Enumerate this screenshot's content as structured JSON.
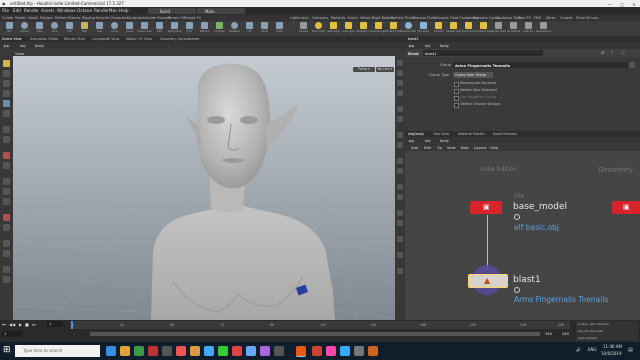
{
  "window": {
    "title": "untitled.hip - Houdini Indie Limited-Commercial 17.5.327",
    "minimize": "—",
    "maximize": "□",
    "close": "✕"
  },
  "menubar": {
    "items": [
      "File",
      "Edit",
      "Render",
      "Assets",
      "Windows",
      "Octane",
      "RenderMan",
      "Help"
    ],
    "build_label": "Build",
    "desktop_label": "Main"
  },
  "shelf_tabs": {
    "left": [
      "Create",
      "Modify",
      "Model",
      "Polygon",
      "Deform",
      "Texture",
      "Rigging",
      "Muscles",
      "Characters",
      "Constraints",
      "Guide Process",
      "Terrain FX",
      "Simple FX"
    ],
    "right": [
      "Lights and...",
      "Collisions",
      "Particles",
      "Grains",
      "Vellum",
      "Rigid Bodies",
      "Particle Fluids",
      "Viscous Fluids",
      "Oceans",
      "Fluid Containers",
      "Populate Conta...",
      "Container Tools",
      "Pyro FX",
      "FEM",
      "Wires",
      "Crowds",
      "Drive Simula..."
    ]
  },
  "toolbar": {
    "left_tools": [
      "Box",
      "Sphere",
      "Tube",
      "Torus",
      "Grid",
      "Null",
      "Line",
      "Circle",
      "Curve",
      "Draw Curve",
      "Path",
      "Spray Paint",
      "Font",
      "Platonic",
      "L-System",
      "Metaball",
      "File",
      "Spiral",
      "Helix"
    ],
    "right_tools": [
      "Camera",
      "Point Light",
      "Spot Light",
      "Area Light",
      "Geometry Light",
      "Volume Light",
      "Distant Light",
      "Environment",
      "Sky Light",
      "GI Light",
      "Caustic Light",
      "Portal Light",
      "Ambient Light",
      "Stereo Camera",
      "VR Camera",
      "Switcher",
      "Gamepad Camera"
    ]
  },
  "left_tabs": [
    "Scene View",
    "Animation Editor",
    "Render View",
    "Composite View",
    "Motion FX View",
    "Geometry Spreadsheet"
  ],
  "viewport": {
    "path_obj": "obj",
    "path_node": "body",
    "view_label": "View",
    "persp_label": "Persp ▾",
    "cam_label": "No cam ▾"
  },
  "params": {
    "tabs": [
      "blast1"
    ],
    "path_obj": "obj",
    "path_node": "body",
    "node_type": "Blast",
    "node_name": "blast1",
    "group_label": "Group",
    "group_value": "Arms Fingernails Toenails",
    "group_type_label": "Group Type",
    "group_type_value": "Guess from Group",
    "checkboxes": [
      "Recompute Normals",
      "Delete Non Selected",
      "Use Negative Group",
      "Delete Unused Groups"
    ]
  },
  "network": {
    "tabs": [
      "/obj/body",
      "Tree View",
      "Material Palette",
      "Asset Browser"
    ],
    "path_obj": "obj",
    "path_node": "body",
    "menu": [
      "Add",
      "Edit",
      "Go",
      "View",
      "Tools",
      "Layout",
      "Help"
    ],
    "context_label": "Indie Edition",
    "geometry_label": "Geometry",
    "node1_type": "File",
    "node1_name": "base_model",
    "node1_file": "elf basic.obj",
    "node2_name": "blast1",
    "node2_group": "Arms Fingernails Toenails"
  },
  "timeline": {
    "frame_current": "1",
    "frame_start": "1",
    "frame_end": "240",
    "frame_end2": "240",
    "ticks": [
      "1",
      "24",
      "48",
      "72",
      "96",
      "120",
      "144",
      "168",
      "192",
      "216",
      "240"
    ],
    "channels_label": "0 keys, 0/0 channels",
    "key_all_label": "Key All Channels",
    "auto_update": "Auto Update"
  },
  "taskbar": {
    "search_placeholder": "Type here to search",
    "time": "11:46 AM",
    "date": "10/6/2019",
    "lang": "ENG"
  },
  "colors": {
    "node_red": "#d8232a",
    "link_blue": "#5aa0e0",
    "viewport_top": "#c5cbd1",
    "viewport_bottom": "#7f8891"
  }
}
